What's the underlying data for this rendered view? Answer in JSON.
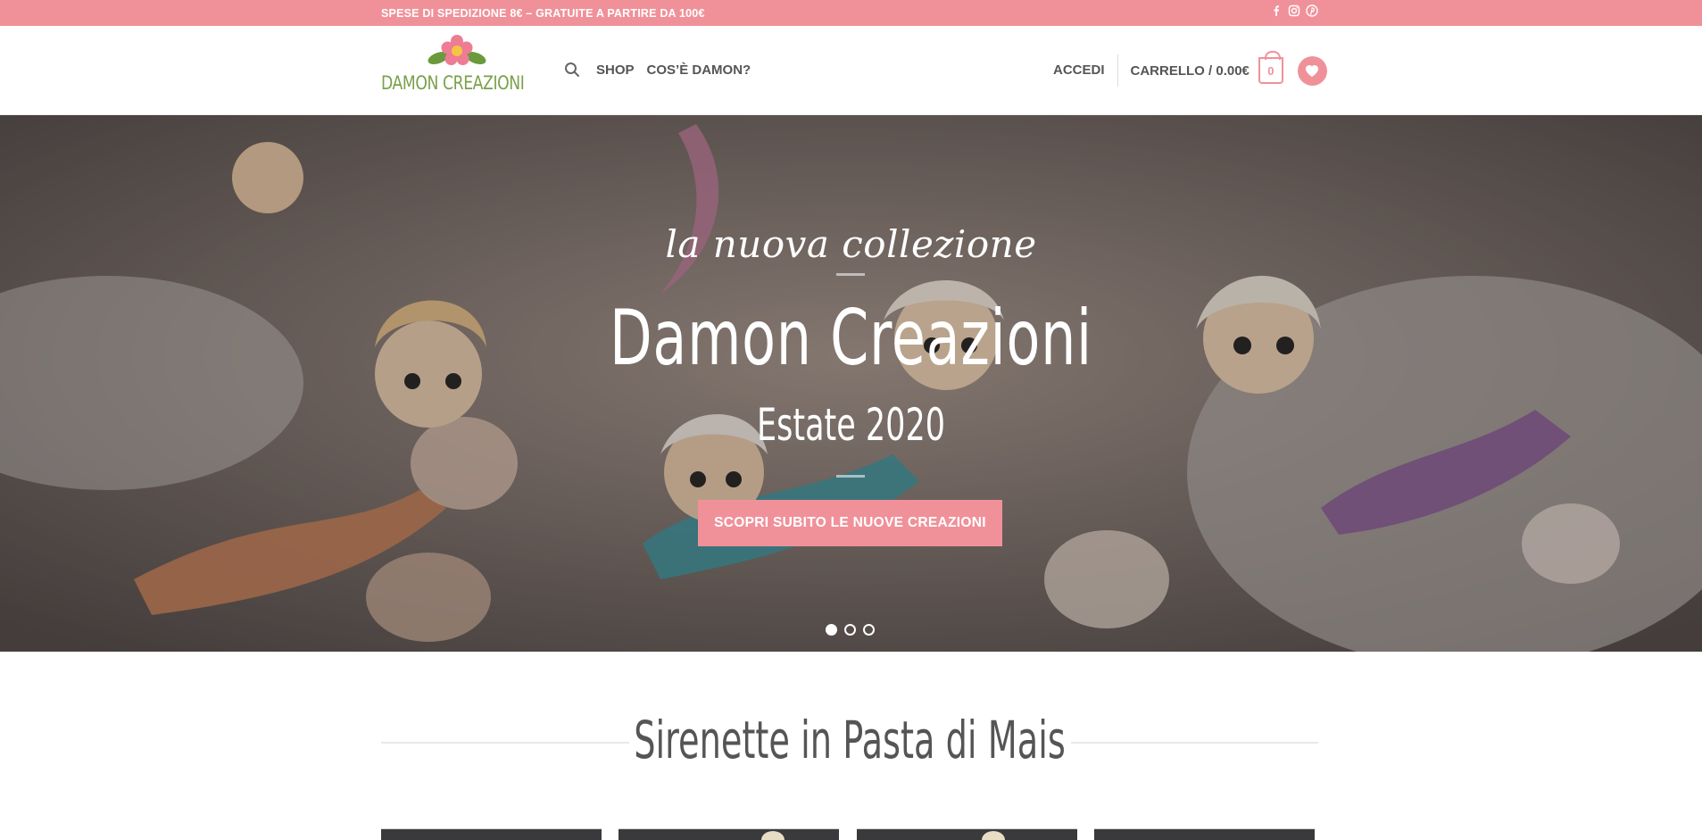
{
  "topbar": {
    "notice": "SPESE DI SPEDIZIONE 8€ – GRATUITE A PARTIRE DA 100€",
    "social_icons": [
      "facebook-icon",
      "instagram-icon",
      "pinterest-icon"
    ]
  },
  "header": {
    "logo_text": "DAMON CREAZIONI",
    "nav": {
      "shop": "SHOP",
      "about": "COS’È DAMON?"
    },
    "account": "ACCEDI",
    "cart_label": "CARRELLO / 0.00€",
    "cart_count": "0"
  },
  "hero": {
    "subtitle": "la nuova collezione",
    "title": "Damon Creazioni",
    "season": "Estate 2020",
    "button": "SCOPRI SUBITO LE NUOVE CREAZIONI",
    "slides": 3,
    "active_slide": 1
  },
  "section": {
    "title": "Sirenette in Pasta di Mais"
  },
  "colors": {
    "accent": "#f0919a",
    "logo_green": "#7aa04a",
    "text": "#555555"
  }
}
